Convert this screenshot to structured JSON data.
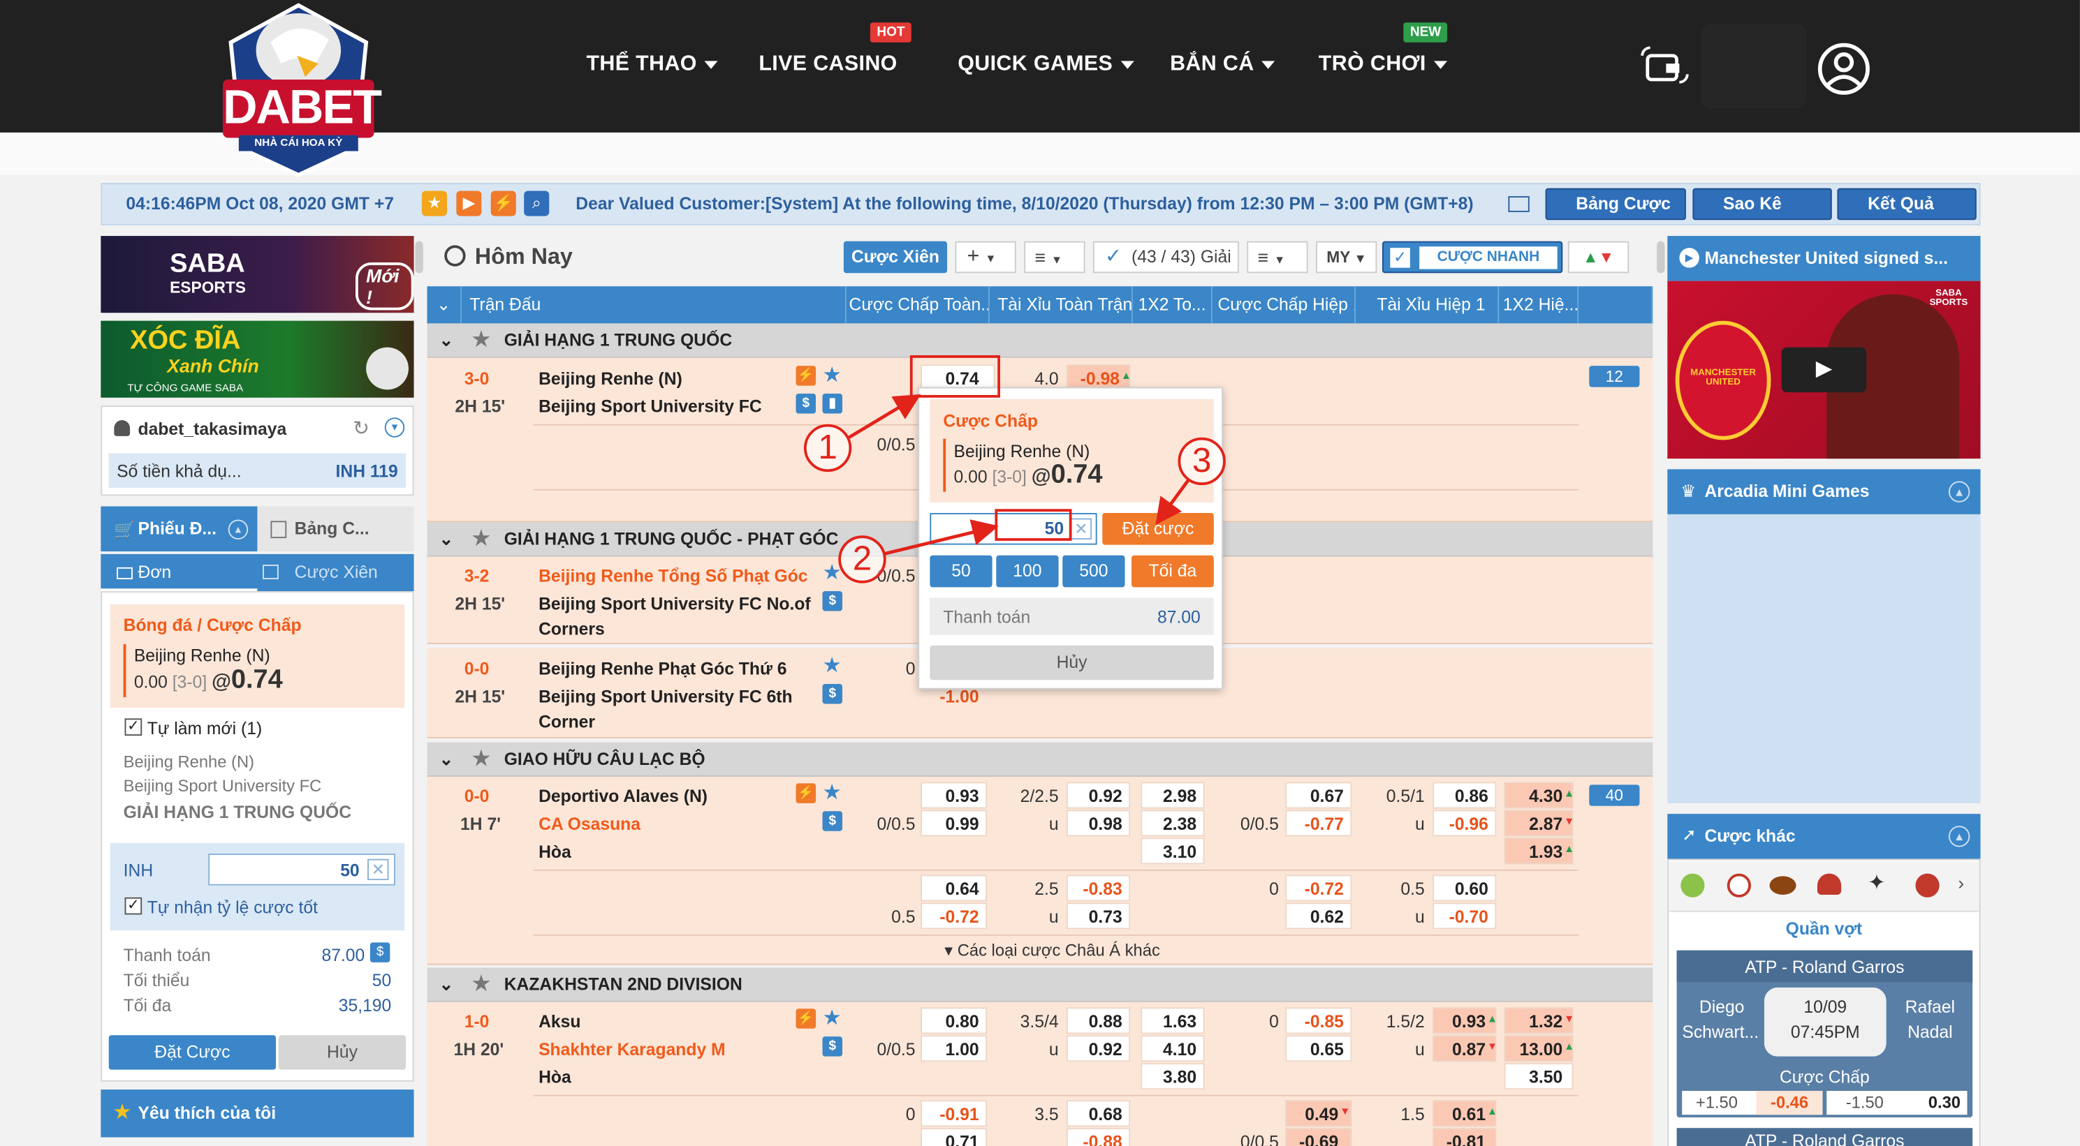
{
  "nav": {
    "logo_text": "DABET",
    "logo_sub": "NHÀ CÁI HOA KỲ",
    "items": [
      {
        "label": "THỂ THAO",
        "dropdown": true
      },
      {
        "label": "LIVE CASINO",
        "badge": "HOT"
      },
      {
        "label": "QUICK GAMES",
        "dropdown": true
      },
      {
        "label": "BẮN CÁ",
        "dropdown": true
      },
      {
        "label": "TRÒ CHƠI",
        "dropdown": true,
        "badge": "NEW"
      }
    ]
  },
  "infobar": {
    "datetime": "04:16:46PM Oct 08, 2020 GMT +7",
    "announcement": "Dear Valued Customer:[System] At the following time, 8/10/2020 (Thursday) from 12:30 PM – 3:00 PM (GMT+8)",
    "buttons": [
      "Bảng Cược",
      "Sao Kê",
      "Kết Quả"
    ]
  },
  "left": {
    "banner1": {
      "brand": "SABA",
      "sub": "ESPORTS",
      "tag": "Mới !"
    },
    "banner2": {
      "line1": "XÓC ĐĨA",
      "line2": "Xanh Chín",
      "line3": "TỰ CÔNG GAME SABA"
    },
    "username": "dabet_takasimaya",
    "balance_label": "Số tiền khả dụ...",
    "balance_value": "INH 119",
    "tabs": [
      "Phiếu Đ...",
      "Bảng C..."
    ],
    "subtabs": [
      "Đơn",
      "Cược Xiên"
    ],
    "slip": {
      "title": "Bóng đá / Cược Chấp",
      "team": "Beijing Renhe (N)",
      "handicap": "0.00",
      "score": "[3-0]",
      "at": "@",
      "odds": "0.74"
    },
    "auto_refresh": "Tự làm mới (1)",
    "home": "Beijing Renhe (N)",
    "away": "Beijing Sport University FC",
    "league": "GIẢI HẠNG 1 TRUNG QUỐC",
    "currency": "INH",
    "stake": "50",
    "accept_better": "Tự nhận tỷ lệ cược tốt",
    "payout_label": "Thanh toán",
    "payout_value": "87.00",
    "min_label": "Tối thiểu",
    "min_value": "50",
    "max_label": "Tối đa",
    "max_value": "35,190",
    "place_btn": "Đặt Cược",
    "cancel_btn": "Hủy",
    "favorites": "Yêu thích của tôi"
  },
  "toolbar": {
    "title": "Hôm Nay",
    "parlay_btn": "Cược Xiên",
    "leagues_count": "(43 / 43) Giải",
    "odds_type": "MY",
    "quick_bet": "CƯỢC NHANH"
  },
  "columns": [
    "Trận Đấu",
    "Cược Chấp Toàn...",
    "Tài Xỉu Toàn Trận",
    "1X2 To...",
    "Cược Chấp Hiệp 1",
    "Tài Xỉu Hiệp 1",
    "1X2 Hiệ..."
  ],
  "leagues": [
    {
      "name": "GIẢI HẠNG 1 TRUNG QUỐC"
    },
    {
      "name": "GIẢI HẠNG 1 TRUNG QUỐC - PHẠT GÓC"
    },
    {
      "name": "GIAO HỮU CÂU LẠC BỘ"
    },
    {
      "name": "KAZAKHSTAN 2ND DIVISION"
    }
  ],
  "m1": {
    "score": "3-0",
    "time": "2H 15'",
    "home": "Beijing Renhe (N)",
    "away": "Beijing Sport University FC",
    "hdp_home_odd": "0.74",
    "hdp_line": "0/0.5",
    "ou_line": "4.0",
    "ou_over": "-0.98",
    "more": "12"
  },
  "m2": {
    "score": "3-2",
    "time": "2H 15'",
    "home": "Beijing Renhe Tổng Số Phạt Góc",
    "away1": "Beijing Sport University FC No.of",
    "away2": "Corners",
    "hdp_line": "0/0.5"
  },
  "m3": {
    "score": "0-0",
    "time": "2H 15'",
    "home": "Beijing Renhe Phạt Góc Thứ 6",
    "away1": "Beijing Sport University FC 6th",
    "away2": "Corner",
    "hdp_line": "0",
    "odd": "-1.00"
  },
  "m4": {
    "score": "0-0",
    "time": "1H 7'",
    "home": "Deportivo Alaves (N)",
    "away": "CA Osasuna",
    "draw": "Hòa",
    "more": "40",
    "r1": {
      "hdp_line": "0/0.5",
      "hdp_h": "0.93",
      "hdp_a": "0.99",
      "ou_line": "2/2.5",
      "ou_u": "u",
      "ou_o": "0.92",
      "ou_un": "0.98",
      "x1": "2.98",
      "x2": "2.38",
      "xd": "3.10",
      "h1_line": "0/0.5",
      "h1_h": "0.67",
      "h1_a": "-0.77",
      "h1ou_line": "0.5/1",
      "h1ou_u": "u",
      "h1ou_o": "0.86",
      "h1ou_un": "-0.96",
      "h1x1": "4.30",
      "h1x2": "2.87",
      "h1xd": "1.93"
    },
    "r2": {
      "hdp_line": "0.5",
      "hdp_h": "0.64",
      "hdp_a": "-0.72",
      "ou_line": "2.5",
      "ou_u": "u",
      "ou_o": "-0.83",
      "ou_un": "0.73",
      "h1_line": "0",
      "h1_h": "-0.72",
      "h1_a": "0.62",
      "h1ou_line": "0.5",
      "h1ou_u": "u",
      "h1ou_o": "0.60",
      "h1ou_un": "-0.70"
    },
    "more_asian": "Các loại cược Châu Á khác"
  },
  "m5": {
    "score": "1-0",
    "time": "1H 20'",
    "home": "Aksu",
    "away": "Shakhter Karagandy M",
    "draw": "Hòa",
    "r1": {
      "hdp_line": "0/0.5",
      "hdp_h": "0.80",
      "hdp_a": "1.00",
      "ou_line": "3.5/4",
      "ou_u": "u",
      "ou_o": "0.88",
      "ou_un": "0.92",
      "x1": "1.63",
      "x2": "4.10",
      "xd": "3.80",
      "h1_line": "0",
      "h1_h": "-0.85",
      "h1_a": "0.65",
      "h1ou_line": "1.5/2",
      "h1ou_u": "u",
      "h1ou_o": "0.93",
      "h1ou_un": "0.87",
      "h1x1": "1.32",
      "h1x2": "13.00",
      "h1xd": "3.50"
    },
    "r2": {
      "hdp_line": "0",
      "hdp_h": "-0.91",
      "hdp_a": "0.71",
      "ou_line": "3.5",
      "ou_o": "0.68",
      "ou_un": "-0.88",
      "h1_line": "0/0.5",
      "h1_h": "0.49",
      "h1_a": "-0.69",
      "h1ou_line": "1.5",
      "h1ou_o": "0.61",
      "h1ou_un": "-0.81"
    }
  },
  "popup": {
    "title": "Cược Chấp",
    "team": "Beijing Renhe (N)",
    "handicap": "0.00",
    "score": "[3-0]",
    "at": "@",
    "odds": "0.74",
    "stake": "50",
    "place": "Đặt cược",
    "quick": [
      "50",
      "100",
      "500"
    ],
    "max": "Tối đa",
    "payout_label": "Thanh toán",
    "payout_value": "87.00",
    "cancel": "Hủy"
  },
  "annotations": [
    "1",
    "2",
    "3"
  ],
  "right": {
    "video_title": "Manchester United signed s...",
    "video_brand": "SABA SPORTS",
    "crest_text": "MANCHESTER UNITED",
    "mini_games": "Arcadia Mini Games",
    "other_bets": "Cược khác",
    "sport_label": "Quần vợt",
    "tennis": {
      "event": "ATP - Roland Garros",
      "p1a": "Diego",
      "p1b": "Schwart...",
      "date": "10/09",
      "time": "07:45PM",
      "p2a": "Rafael",
      "p2b": "Nadal",
      "market": "Cược Chấp",
      "h1": "+1.50",
      "o1": "-0.46",
      "h2": "-1.50",
      "o2": "0.30"
    },
    "tennis2_event": "ATP - Roland Garros"
  },
  "colors": {
    "accent": "#3a86c8",
    "orange": "#f05a1a",
    "row": "#fce6d8",
    "nav": "#212121"
  }
}
